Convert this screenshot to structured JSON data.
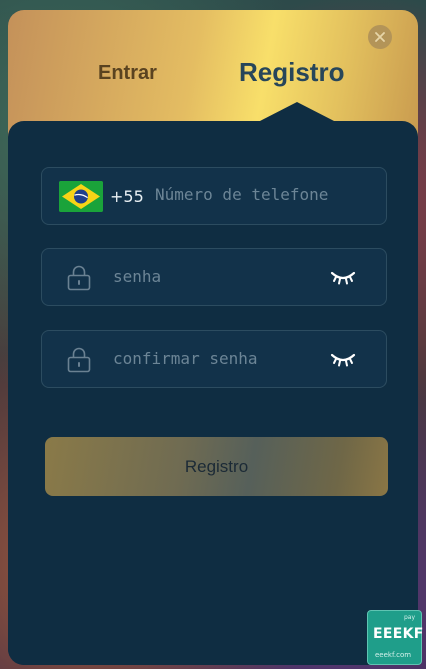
{
  "tabs": {
    "login": "Entrar",
    "register": "Registro"
  },
  "active_tab": "Registro",
  "phone": {
    "country_flag": "brazil-flag-icon",
    "dial_code": "+55",
    "placeholder": "Número de telefone",
    "value": ""
  },
  "password": {
    "placeholder": "senha",
    "value": ""
  },
  "confirm_password": {
    "placeholder": "confirmar senha",
    "value": ""
  },
  "submit_label": "Registro",
  "badge": {
    "top": "pay",
    "brand": "EEEKF",
    "url": "eeekf.com"
  },
  "colors": {
    "panel": "#0f2d42",
    "header_gold": "#f8df6a",
    "field_border": "#2c4c60",
    "active_tab": "#27465a"
  }
}
